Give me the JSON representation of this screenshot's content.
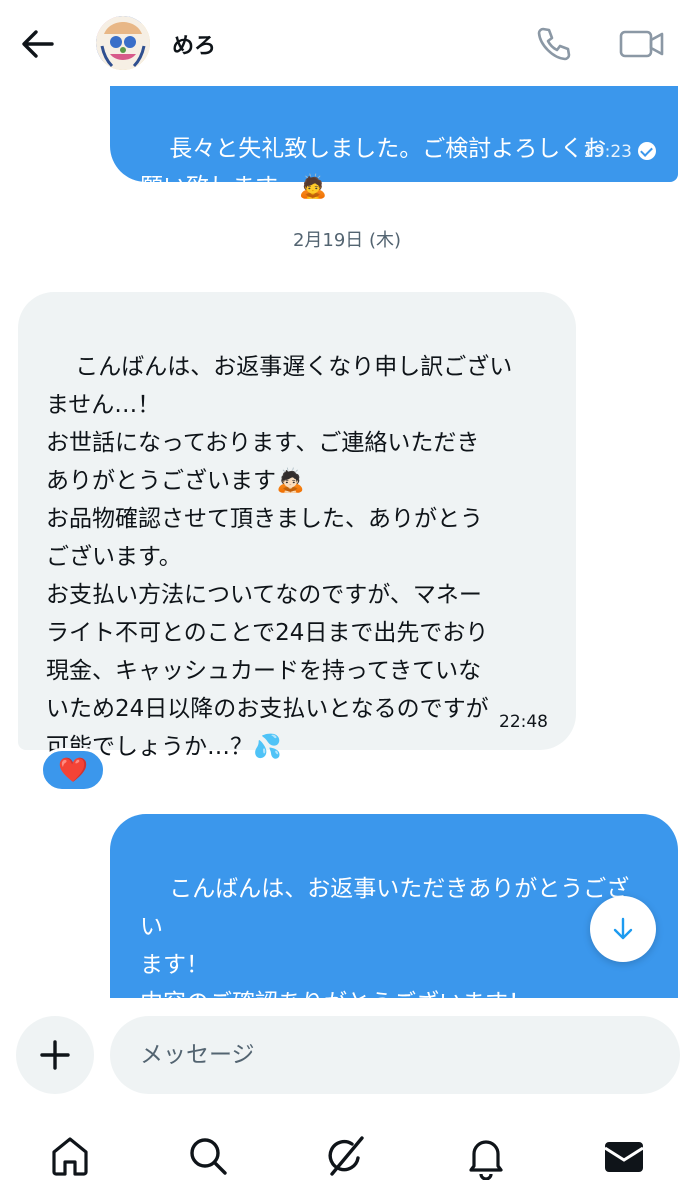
{
  "header": {
    "contact_name": "めろ",
    "icons": [
      "back-arrow-icon",
      "phone-icon",
      "video-camera-icon"
    ]
  },
  "messages": [
    {
      "direction": "outgoing",
      "text": "長々と失礼致しました。ご検討よろしくお\n願い致します。🙇",
      "time": "19:23",
      "read": true
    },
    {
      "type": "date_separator",
      "text": "2月19日 (木)"
    },
    {
      "direction": "incoming",
      "text": "こんばんは、お返事遅くなり申し訳ござい\nません…！\nお世話になっております、ご連絡いただき\nありがとうございます🙇🏻\nお品物確認させて頂きました、ありがとう\nございます。\nお支払い方法についてなのですが、マネー\nライト不可とのことで24日まで出先でおり\n現金、キャッシュカードを持ってきていな\nいため24日以降のお支払いとなるのですが\n可能でしょうか…？💦",
      "time": "22:48",
      "reaction": "❤️"
    },
    {
      "direction": "outgoing",
      "text": "こんばんは、お返事いただきありがとうござい\nます！\n内容のご確認ありがとうございます！\nお支払いについて了解いたしました。お支"
    }
  ],
  "composer": {
    "placeholder": "メッセージ"
  },
  "tabs": [
    "home-icon",
    "search-icon",
    "grok-icon",
    "notifications-icon",
    "messages-icon"
  ],
  "colors": {
    "outgoing_bubble": "#3b97ec",
    "incoming_bubble": "#eff3f4",
    "reaction_heart": "#f4212e"
  }
}
